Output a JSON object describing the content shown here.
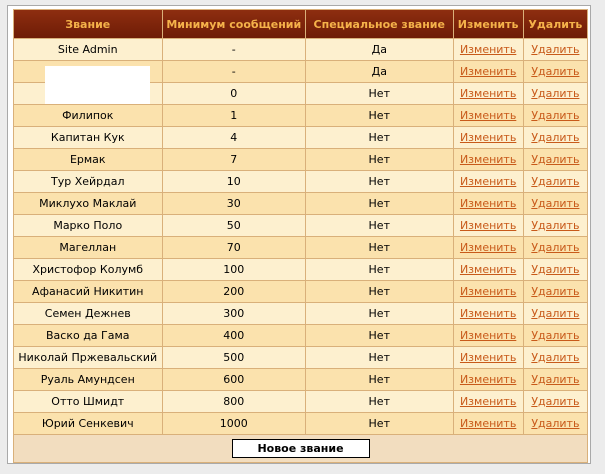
{
  "headers": {
    "rank": "Звание",
    "min_posts": "Минимум сообщений",
    "special": "Специальное звание",
    "edit": "Изменить",
    "delete": "Удалить"
  },
  "rows": [
    {
      "name": "Site Admin",
      "min": "-",
      "special": "Да"
    },
    {
      "name": "",
      "min": "-",
      "special": "Да"
    },
    {
      "name": "",
      "min": "0",
      "special": "Нет"
    },
    {
      "name": "Филипок",
      "min": "1",
      "special": "Нет"
    },
    {
      "name": "Капитан Кук",
      "min": "4",
      "special": "Нет"
    },
    {
      "name": "Ермак",
      "min": "7",
      "special": "Нет"
    },
    {
      "name": "Тур Хейрдал",
      "min": "10",
      "special": "Нет"
    },
    {
      "name": "Миклухо Маклай",
      "min": "30",
      "special": "Нет"
    },
    {
      "name": "Марко Поло",
      "min": "50",
      "special": "Нет"
    },
    {
      "name": "Магеллан",
      "min": "70",
      "special": "Нет"
    },
    {
      "name": "Христофор Колумб",
      "min": "100",
      "special": "Нет"
    },
    {
      "name": "Афанасий Никитин",
      "min": "200",
      "special": "Нет"
    },
    {
      "name": "Семен Дежнев",
      "min": "300",
      "special": "Нет"
    },
    {
      "name": "Васко да Гама",
      "min": "400",
      "special": "Нет"
    },
    {
      "name": "Николай Пржевальский",
      "min": "500",
      "special": "Нет"
    },
    {
      "name": "Руаль Амундсен",
      "min": "600",
      "special": "Нет"
    },
    {
      "name": "Отто Шмидт",
      "min": "800",
      "special": "Нет"
    },
    {
      "name": "Юрий Сенкевич",
      "min": "1000",
      "special": "Нет"
    }
  ],
  "edit_label": "Изменить",
  "delete_label": "Удалить",
  "new_rank_button": "Новое звание",
  "colors": {
    "header_bg": "#7a240a",
    "header_text": "#f5b24a",
    "row_light": "#fdf0cf",
    "row_dark": "#fbe2ad",
    "link": "#c85a1a"
  }
}
